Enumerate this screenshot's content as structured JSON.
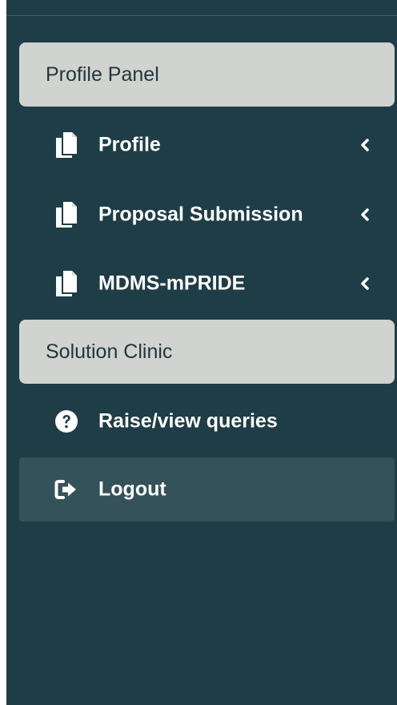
{
  "sidebar": {
    "profile_panel_header": "Profile Panel",
    "profile_items": [
      {
        "label": "Profile",
        "icon": "copy-document-icon",
        "has_chevron": true
      },
      {
        "label": "Proposal Submission",
        "icon": "copy-document-icon",
        "has_chevron": true
      },
      {
        "label": "MDMS-mPRIDE",
        "icon": "copy-document-icon",
        "has_chevron": true
      }
    ],
    "solution_clinic_header": "Solution Clinic",
    "solution_items": [
      {
        "label": "Raise/view queries",
        "icon": "question-circle-icon"
      },
      {
        "label": "Logout",
        "icon": "logout-icon",
        "active": true
      }
    ]
  },
  "colors": {
    "sidebar_bg": "#1f3d46",
    "header_bg": "#d0d3cf",
    "active_item_bg": "#355159",
    "text_light": "#ffffff",
    "text_dark": "#23373c"
  }
}
